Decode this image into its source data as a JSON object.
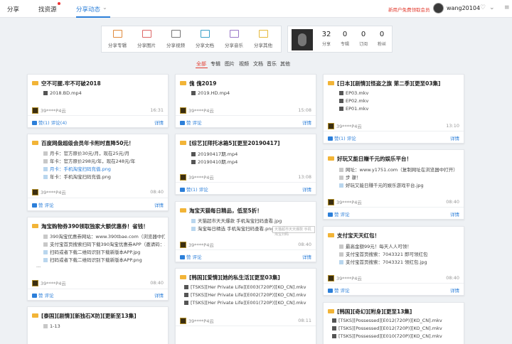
{
  "header": {
    "nav": [
      "分享",
      "找资源",
      "分享动态"
    ],
    "promo": "新用户免费领取会员",
    "username": "wang20104"
  },
  "toolbar": {
    "items": [
      "分享专辑",
      "分享图片",
      "分享视频",
      "分享文档",
      "分享音乐",
      "分享其他"
    ]
  },
  "stats": [
    {
      "value": "32",
      "label": "分享"
    },
    {
      "value": "0",
      "label": "专辑"
    },
    {
      "value": "0",
      "label": "订阅"
    },
    {
      "value": "0",
      "label": "粉丝"
    }
  ],
  "filters": [
    "全部",
    "专辑",
    "图片",
    "视频",
    "文档",
    "音乐",
    "其他"
  ],
  "tooltip": "天猫超市天天爆款 手机淘宝扫码",
  "common": {
    "like": "赞",
    "comment": "评论",
    "detail": "详情"
  },
  "cards": {
    "c1": {
      "title": "空不可腥.牢不可破2018",
      "files": [
        "2018.BD.mp4"
      ],
      "owner": "39****P4云",
      "time": "16:31",
      "like": "赞(1)",
      "comment": "评论(4)"
    },
    "c2": {
      "title": "百度网盘超级会员年卡附时直降50元！",
      "files": [
        "月卡：官方原价30元/月，现在25元/月",
        "年卡：官方原价298元/年，现在248元/年",
        "月卡：手机淘宝扫码充值.png",
        "年卡：手机淘宝扫码充值.png"
      ],
      "owner": "39****P4云",
      "time": "08:40"
    },
    "c3": {
      "title": "淘宝购物券390领取独家大额优惠券！省钱！",
      "files": [
        "390淘宝优惠券网站：www.390tbae.com（浏览器中打开）",
        "支付宝首页搜索扫码下载390淘宝优惠券APP（邀请码：390劵）",
        "扫码或者下载二维码识别下载新版本APP.jpg",
        "扫码或者下载二维码识别下载新版本APP.png",
        "..."
      ],
      "owner": "39****P4云",
      "time": "08:40"
    },
    "c4": {
      "title": "[泰国][剧情][新独石X防][更新至13集]",
      "files": [
        "1-13"
      ]
    },
    "c5": {
      "title": "傀 傀2019",
      "files": [
        "2019.HD.mp4"
      ],
      "owner": "39****P4云",
      "time": "15:08"
    },
    "c6": {
      "title": "[综艺][拜托冰箱5][更至20190417]",
      "files": [
        "20190417期.mp4",
        "20190410期.mp4"
      ],
      "owner": "39****P4云",
      "time": "13:08",
      "like": "赞(1)"
    },
    "c7": {
      "title": "淘宝天猫每日精品，低至5折！",
      "files": [
        "天猫超市天天爆款 手机淘宝扫码查看.jpg",
        "淘宝每日精选 手机淘宝扫码查看.png"
      ],
      "owner": "39****P4云",
      "time": "08:40"
    },
    "c8": {
      "title": "[韩国][爱情][她的私生活][更至03集]",
      "files": [
        "[TSKS][Her Private Life][E003(720P)][KO_CN].mkv",
        "[TSKS][Her Private Life][E002(720P)][KO_CN].mkv",
        "[TSKS][Her Private Life][E001(720P)][KO_CN].mkv"
      ],
      "owner": "39****P4云",
      "time": "08:11"
    },
    "c9": {
      "title": "[日本][剧情][怪盗之旗 第二季][更至03集]",
      "files": [
        "EP03.mkv",
        "EP02.mkv",
        "EP01.mkv"
      ],
      "owner": "39****P4云",
      "time": "13:10",
      "like": "赞(1)"
    },
    "c10": {
      "title": "好玩又能日赚千元的娱乐平台！",
      "files": [
        "网址：www.y1751.com（复制网址在浏览器中打开）",
        "步 骤！",
        "好玩又能日赚千元的娱乐游戏平台.jpg"
      ],
      "owner": "39****P4云",
      "time": "08:40"
    },
    "c11": {
      "title": "支付宝天天红包！",
      "files": [
        "最高金额99元！每天人人可领！",
        "支付宝首页搜索：7043321 即可领红包",
        "支付宝首页搜索：7043321 领红包.jpg"
      ],
      "owner": "39****P4云",
      "time": "08:40"
    },
    "c12": {
      "title": "[韩国][奇幻][附身][更至13集]",
      "files": [
        "[TSKS][Possessed][E012(720P)][KO_CN].mkv",
        "[TSKS][Possessed][E012(720P)][KO_CN].mkv",
        "[TSKS][Possessed][E010(720P)][KO_CN].mkv"
      ]
    }
  },
  "colors": {
    "accent": "#2c7fd9",
    "red": "#e23b2e",
    "folder": "#f2b437",
    "page_bg": "#eef1f4"
  }
}
